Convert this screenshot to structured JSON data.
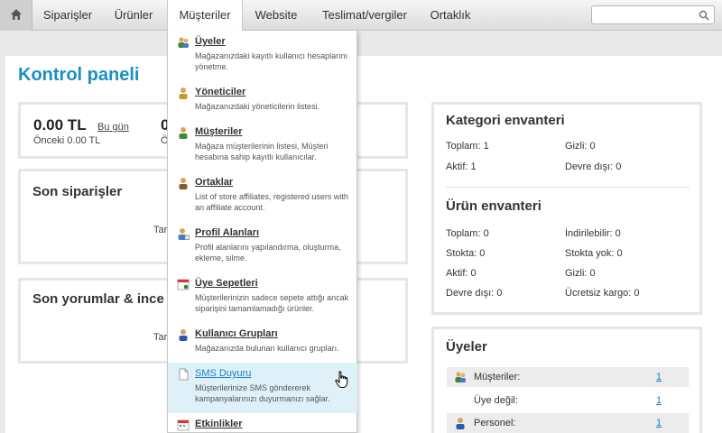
{
  "nav": {
    "home_icon": "home-icon",
    "items": [
      "Siparişler",
      "Ürünler",
      "Müşteriler",
      "Website",
      "Teslimat/vergiler",
      "Ortaklık"
    ],
    "active": "Müşteriler",
    "search_value": ""
  },
  "page": {
    "title": "Kontrol paneli"
  },
  "sales": {
    "amount": "0.00 TL",
    "period_link": "Bu gün",
    "previous": "Önceki 0.00 TL",
    "second_amount_partial": "0",
    "second_previous_partial": "Ö"
  },
  "orders": {
    "title": "Son siparişler",
    "partial_text": "Tar"
  },
  "reviews": {
    "title": "Son yorumlar & ince",
    "partial_text": "Tar"
  },
  "category_inventory": {
    "title": "Kategori envanteri",
    "total": "Toplam: 1",
    "hidden": "Gizli: 0",
    "active": "Aktif: 1",
    "disabled": "Devre dışı: 0"
  },
  "product_inventory": {
    "title": "Ürün envanteri",
    "total": "Toplam: 0",
    "downloadable": "İndirilebilir: 0",
    "in_stock": "Stokta: 0",
    "out_of_stock": "Stokta yok: 0",
    "active": "Aktif: 0",
    "hidden": "Gizli: 0",
    "disabled": "Devre dışı: 0",
    "free_shipping": "Ücretsiz kargo: 0"
  },
  "members": {
    "title": "Üyeler",
    "rows": [
      {
        "label": "Müşteriler:",
        "value": "1",
        "icon": "customers-icon"
      },
      {
        "label": "Üye değil:",
        "value": "1",
        "icon": ""
      },
      {
        "label": "Personel:",
        "value": "1",
        "icon": "staff-icon"
      }
    ]
  },
  "dropdown": {
    "items": [
      {
        "title": "Üyeler",
        "desc": "Mağazanızdaki kayıtlı kullanıcı hesaplarını yönetme.",
        "icon": "users-icon"
      },
      {
        "title": "Yöneticiler",
        "desc": "Mağazanızdaki yöneticilerin listesi.",
        "icon": "admin-icon"
      },
      {
        "title": "Müşteriler",
        "desc": "Mağaza müşterilerinin listesi, Müşteri hesabına sahip kayıtlı kullanıcılar.",
        "icon": "customer-icon"
      },
      {
        "title": "Ortaklar",
        "desc": "List of store affiliates, registered users with an affiliate account.",
        "icon": "affiliate-icon"
      },
      {
        "title": "Profil Alanları",
        "desc": "Profil alanlarını yapılandırma, oluşturma, ekleme, silme.",
        "icon": "profile-fields-icon"
      },
      {
        "title": "Üye Sepetleri",
        "desc": "Müşterilerinizin sadece sepete attığı ancak siparişini tamamlamadığı ürünler.",
        "icon": "cart-icon"
      },
      {
        "title": "Kullanıcı Grupları",
        "desc": "Mağazanızda bulunan kullanıcı grupları.",
        "icon": "user-groups-icon"
      },
      {
        "title": "SMS Duyuru",
        "desc": "Müşterilerinize SMS göndererek kampanyalarınızı duyurmanızı sağlar.",
        "icon": "sms-icon"
      },
      {
        "title": "Etkinlikler",
        "desc": "",
        "icon": "calendar-icon"
      }
    ]
  }
}
